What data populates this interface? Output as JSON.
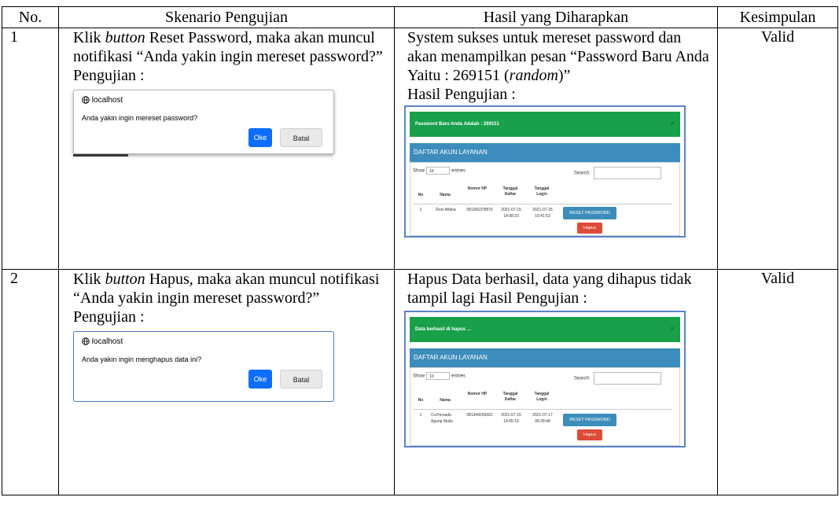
{
  "headers": [
    "No.",
    "Skenario Pengujian",
    "Hasil yang Diharapkan",
    "Kesimpulan"
  ],
  "rows": [
    {
      "no": "1",
      "scenario_parts": [
        "Klik ",
        "button",
        " Reset Password, maka akan muncul notifikasi “Anda yakin ingin mereset password?”"
      ],
      "scenario_test_label": "Pengujian :",
      "dialog": {
        "host": "localhost",
        "message": "Anda yakin ingin mereset password?",
        "ok": "Oke",
        "cancel": "Batal"
      },
      "expected_parts": [
        "System sukses untuk mereset password dan akan menampilkan pesan “Password Baru Anda Yaitu : 269151 (",
        "random",
        ")”"
      ],
      "result_label": "Hasil Pengujian :",
      "panel": {
        "alert": "Password Baru Anda Adalah : 269151",
        "alert_close": "×",
        "title": "DAFTAR AKUN LAYANAN",
        "show": "Show",
        "entries_value": "10",
        "entries": "entries",
        "search": "Search:",
        "columns": [
          "No",
          "Nama",
          "Nomor HP",
          "Tanggal Daftar",
          "Tanggal Login"
        ],
        "row": {
          "no": "1",
          "nama": "Roni Aflaha",
          "hp": "081266378876",
          "daftar": "2021-07-15 14:08:20",
          "login": "2021-07-25 16:41:53"
        },
        "reset_btn": "RESET PASSWORD",
        "delete_btn": "Hapus"
      },
      "conclusion": "Valid"
    },
    {
      "no": "2",
      "scenario_parts": [
        "Klik ",
        "button",
        " Hapus, maka akan muncul notifikasi “Anda yakin ingin mereset password?”"
      ],
      "scenario_test_label": "Pengujian :",
      "dialog": {
        "host": "localhost",
        "message": "Anda yakin ingin menghapus data ini?",
        "ok": "Oke",
        "cancel": "Batal"
      },
      "expected_text": "Hapus Data berhasil, data yang dihapus tidak tampil lagi Hasil Pengujian :",
      "panel": {
        "alert": "Data berhasil di hapus ...",
        "alert_close": "×",
        "title": "DAFTAR AKUN LAYANAN",
        "show": "Show",
        "entries_value": "10",
        "entries": "entries",
        "search": "Search:",
        "columns": [
          "No",
          "Nama",
          "Nomor HP",
          "Tanggal Daftar",
          "Tanggal Login"
        ],
        "row": {
          "no": "1",
          "nama": "Cv.Persada Agung Mulia",
          "hp": "081344256662",
          "daftar": "2021-07-15 14:05:19",
          "login": "2021-07-17 08:28:48"
        },
        "reset_btn": "RESET PASSWORD",
        "delete_btn": "Hapus"
      },
      "conclusion": "Valid"
    }
  ]
}
